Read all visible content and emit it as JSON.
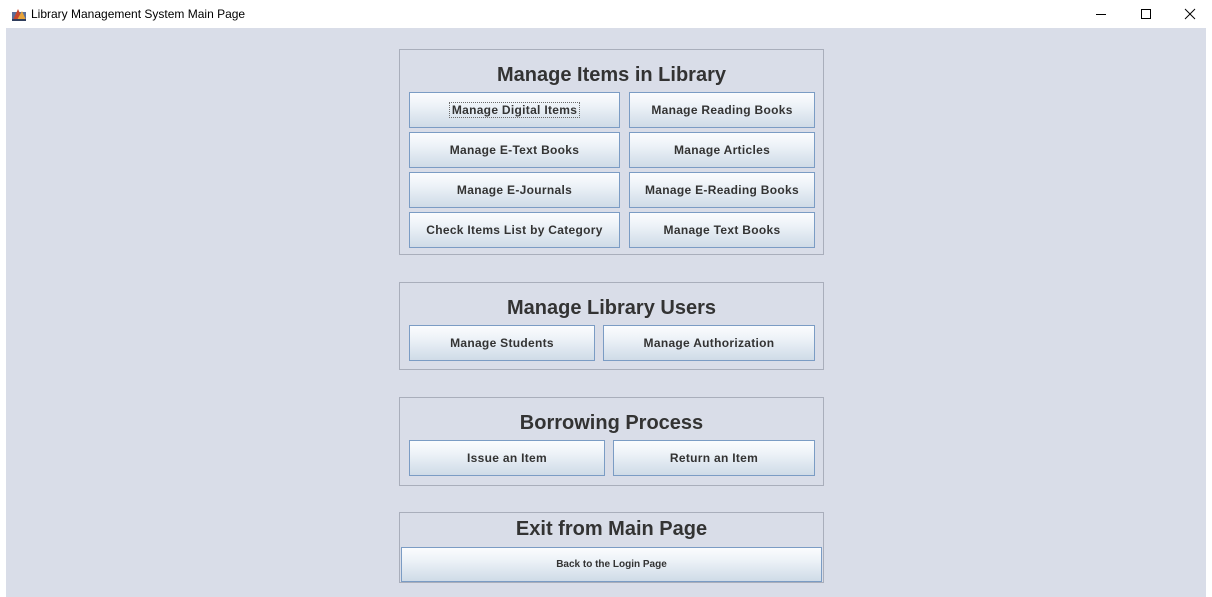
{
  "window": {
    "title": "Library Management System Main Page",
    "controls": {
      "minimize_icon": "minimize-icon",
      "maximize_icon": "maximize-icon",
      "close_icon": "close-icon"
    }
  },
  "colors": {
    "background": "#d9dde8",
    "panel_border": "#a9aebb",
    "button_border": "#7b9cc4",
    "text": "#333333"
  },
  "sections": {
    "items": {
      "title": "Manage Items in Library",
      "buttons": {
        "digital_items": "Manage Digital Items",
        "reading_books": "Manage Reading Books",
        "etext_books": "Manage E-Text Books",
        "articles": "Manage Articles",
        "ejournals": "Manage E-Journals",
        "ereading_books": "Manage E-Reading Books",
        "check_by_category": "Check Items List by Category",
        "text_books": "Manage Text Books"
      }
    },
    "users": {
      "title": "Manage Library Users",
      "buttons": {
        "students": "Manage Students",
        "authorization": "Manage Authorization"
      }
    },
    "borrowing": {
      "title": "Borrowing Process",
      "buttons": {
        "issue": "Issue an Item",
        "return": "Return an Item"
      }
    },
    "exit": {
      "title": "Exit from Main Page",
      "buttons": {
        "back_to_login": "Back to the Login Page"
      }
    }
  }
}
